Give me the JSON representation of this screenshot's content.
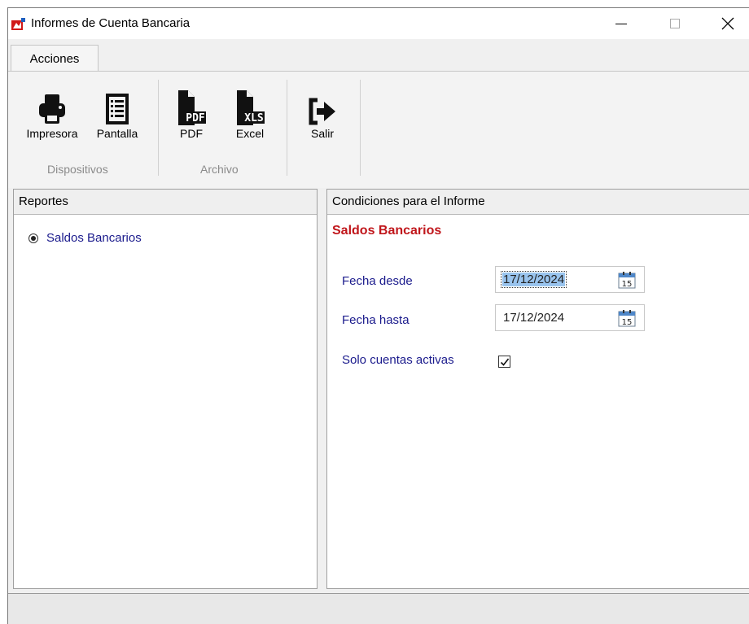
{
  "window": {
    "title": "Informes de Cuenta Bancaria",
    "icon": "app-logo-icon",
    "controls": [
      "minimize-icon",
      "maximize-icon",
      "close-icon"
    ]
  },
  "ribbon": {
    "tab": "Acciones",
    "groups": [
      {
        "label": "Dispositivos",
        "buttons": [
          {
            "label": "Impresora",
            "icon": "printer-icon"
          },
          {
            "label": "Pantalla",
            "icon": "screen-list-icon"
          }
        ]
      },
      {
        "label": "Archivo",
        "buttons": [
          {
            "label": "PDF",
            "icon": "pdf-file-icon"
          },
          {
            "label": "Excel",
            "icon": "xls-file-icon"
          }
        ]
      },
      {
        "label": "",
        "buttons": [
          {
            "label": "Salir",
            "icon": "exit-icon"
          }
        ]
      }
    ]
  },
  "reports_panel": {
    "header": "Reportes",
    "items": [
      {
        "label": "Saldos Bancarios",
        "selected": true
      }
    ]
  },
  "conditions_panel": {
    "header": "Condiciones para el Informe",
    "report_title": "Saldos Bancarios",
    "fecha_desde": {
      "label": "Fecha desde",
      "value": "17/12/2024",
      "calendar_day": "15"
    },
    "fecha_hasta": {
      "label": "Fecha hasta",
      "value": "17/12/2024",
      "calendar_day": "15"
    },
    "solo_activas": {
      "label": "Solo cuentas activas",
      "checked": true
    }
  },
  "colors": {
    "report_title": "#c0161b",
    "field_label": "#1a1a8c",
    "selection": "#99c4ee"
  }
}
